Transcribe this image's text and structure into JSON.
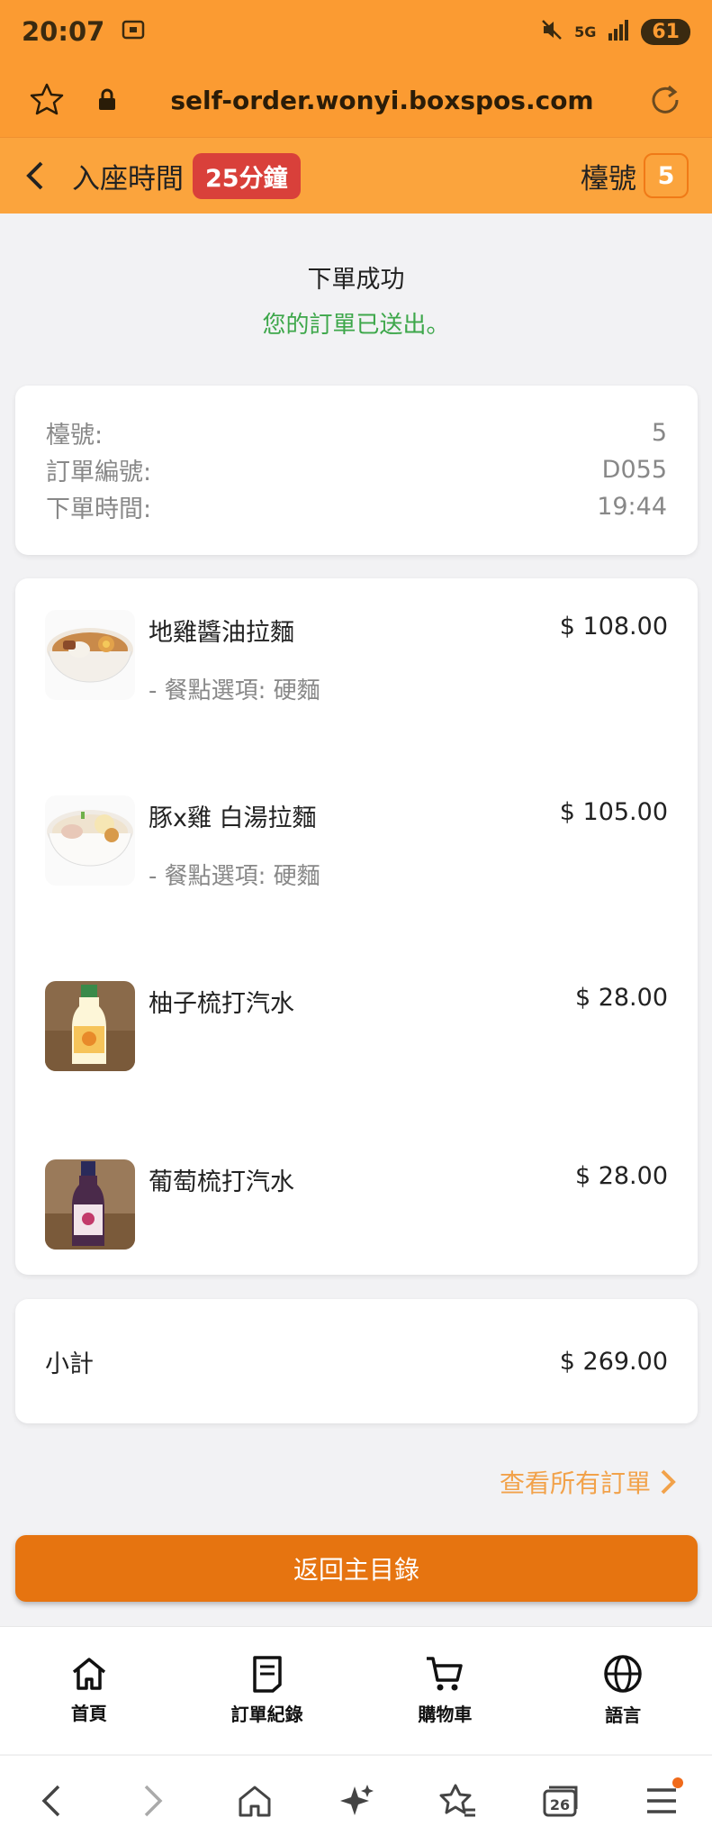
{
  "status": {
    "time": "20:07",
    "battery": "61",
    "signal_text": "5G"
  },
  "browser": {
    "url": "self-order.wonyi.boxspos.com"
  },
  "header": {
    "title": "入座時間",
    "duration": "25分鐘",
    "table_label": "檯號",
    "table_number": "5"
  },
  "success": {
    "title": "下單成功",
    "subtitle": "您的訂單已送出。"
  },
  "order_info": [
    {
      "label": "檯號:",
      "value": "5"
    },
    {
      "label": "訂單編號:",
      "value": "D055"
    },
    {
      "label": "下單時間:",
      "value": "19:44"
    }
  ],
  "items": [
    {
      "name": "地雞醬油拉麵",
      "price": "$ 108.00",
      "option": "- 餐點選項: 硬麵",
      "thumb": "ramen-shoyu"
    },
    {
      "name": "豚x雞 白湯拉麵",
      "price": "$ 105.00",
      "option": "- 餐點選項: 硬麵",
      "thumb": "ramen-white"
    },
    {
      "name": "柚子梳打汽水",
      "price": "$ 28.00",
      "option": "",
      "thumb": "yuzu-soda"
    },
    {
      "name": "葡萄梳打汽水",
      "price": "$ 28.00",
      "option": "",
      "thumb": "grape-soda"
    }
  ],
  "subtotal": {
    "label": "小計",
    "value": "$ 269.00"
  },
  "view_all": "查看所有訂單",
  "return_button": "返回主目錄",
  "bottom_nav": [
    {
      "label": "首頁",
      "icon": "home-icon"
    },
    {
      "label": "訂單紀錄",
      "icon": "receipt-icon"
    },
    {
      "label": "購物車",
      "icon": "cart-icon"
    },
    {
      "label": "語言",
      "icon": "globe-icon"
    }
  ],
  "browser_nav": {
    "tab_count": "26"
  },
  "colors": {
    "brand": "#fb9b32",
    "accent": "#e67410",
    "success": "#3da74a",
    "badge": "#d9403a"
  }
}
